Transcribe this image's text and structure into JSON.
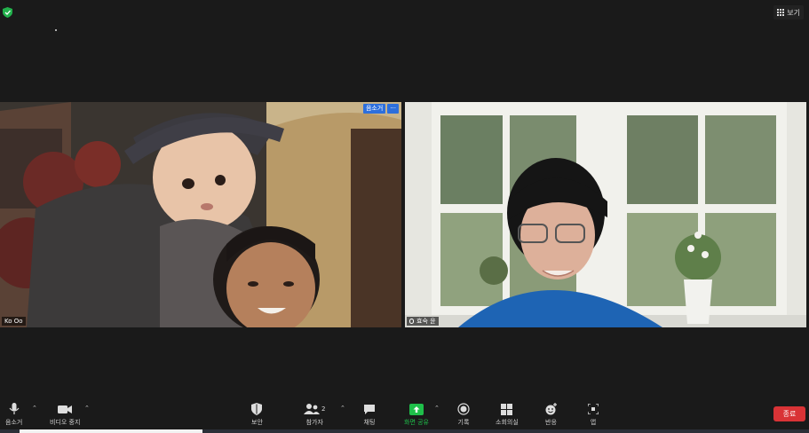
{
  "top_right": {
    "view_label": "보기",
    "view_icon": "grid-icon"
  },
  "security_icon": "shield-check-icon",
  "participants": [
    {
      "name": "Ko Oo",
      "actions": [
        "음소거",
        "···"
      ]
    },
    {
      "name": "효숙 윤"
    }
  ],
  "toolbar": {
    "mute": "음소거",
    "stop_video": "비디오 중지",
    "security": "보안",
    "participants": "참가자",
    "participants_count": "2",
    "chat": "채팅",
    "share_screen": "화면 공유",
    "record": "기록",
    "breakout": "소회의실",
    "reactions": "반응",
    "apps": "앱",
    "end": "종료"
  },
  "colors": {
    "background": "#1a1a1a",
    "accent_green": "#1fbf4a",
    "end_red": "#d93336",
    "tile_action_blue": "#2d6fdc"
  }
}
